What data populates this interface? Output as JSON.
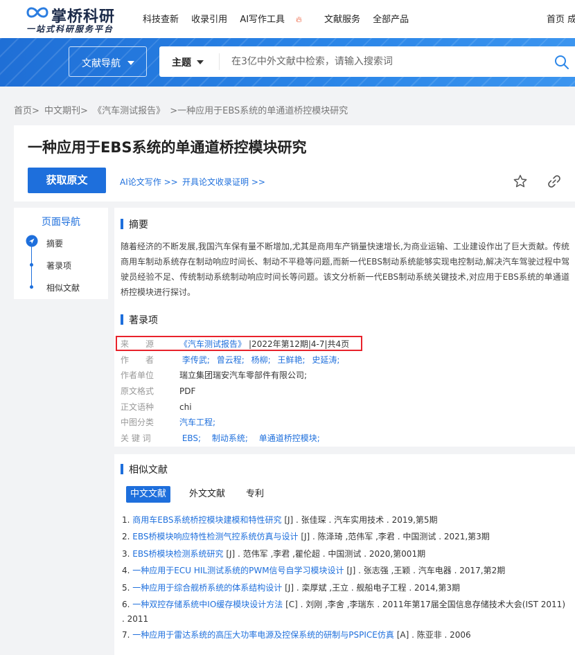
{
  "header": {
    "logo_title": "掌桥科研",
    "logo_subtitle": "一站式科研服务平台",
    "nav": [
      "科技查新",
      "收录引用",
      "AI写作工具",
      "文献服务",
      "全部产品"
    ],
    "nav_right": "首页 成"
  },
  "banner": {
    "lit_nav_label": "文献导航",
    "search_scope": "主题",
    "search_placeholder": "在3亿中外文献中检索，请输入搜索词"
  },
  "breadcrumb": [
    "首页>",
    "中文期刊>",
    "《汽车测试报告》",
    ">一种应用于EBS系统的单通道桥控模块研究"
  ],
  "paper": {
    "title": "一种应用于EBS系统的单通道桥控模块研究",
    "get_button": "获取原文",
    "link_ai": "AI论文写作 >>",
    "link_cert": "开具论文收录证明 >>"
  },
  "page_nav": {
    "title": "页面导航",
    "items": [
      "摘要",
      "著录项",
      "相似文献"
    ]
  },
  "abstract": {
    "heading": "摘要",
    "text": "随着经济的不断发展,我国汽车保有量不断增加,尤其是商用车产销量快速增长,为商业运输、工业建设作出了巨大贡献。传统商用车制动系统存在制动响应时间长、制动不平稳等问题,而新一代EBS制动系统能够实现电控制动,解决汽车驾驶过程中驾驶员经验不足、传统制动系统制动响应时间长等问题。该文分析新一代EBS制动系统关键技术,对应用于EBS系统的单通道桥控模块进行探讨。"
  },
  "record": {
    "heading": "著录项",
    "source": {
      "key": "来　　源",
      "journal": "《汽车测试报告》",
      "rest": "|2022年第12期|4-7|共4页"
    },
    "authors": {
      "key": "作　　者",
      "values": [
        "李传武;",
        "曾云程;",
        "杨柳;",
        "王鲜艳;",
        "史延涛;"
      ]
    },
    "affiliation": {
      "key": "作者单位",
      "value": "瑞立集团瑞安汽车零部件有限公司;"
    },
    "format": {
      "key": "原文格式",
      "value": "PDF"
    },
    "language": {
      "key": "正文语种",
      "value": "chi"
    },
    "classification": {
      "key": "中图分类",
      "value": "汽车工程;"
    },
    "keywords": {
      "key": "关 键 词",
      "values": [
        "EBS;",
        "制动系统;",
        "单通道桥控模块;"
      ]
    }
  },
  "similar": {
    "heading": "相似文献",
    "tabs": [
      "中文文献",
      "外文文献",
      "专利"
    ],
    "refs": [
      {
        "num": "1.",
        "title": "商用车EBS系统桥控模块建模和特性研究",
        "rest": " [J] . 张佳琛 . 汽车实用技术 . 2019,第5期"
      },
      {
        "num": "2.",
        "title": "EBS桥模块响应特性检测气控系统仿真与设计",
        "rest": " [J] . 陈泽琦 ,范伟军 ,李君 . 中国测试 . 2021,第3期"
      },
      {
        "num": "3.",
        "title": "EBS桥模块检测系统研究",
        "rest": " [J] . 范伟军 ,李君 ,瞿伦超 . 中国测试 . 2020,第001期"
      },
      {
        "num": "4.",
        "title": "一种应用于ECU HIL测试系统的PWM信号自学习模块设计",
        "rest": " [J] . 张志强 ,王颖 . 汽车电器 . 2017,第2期"
      },
      {
        "num": "5.",
        "title": "一种应用于综合舰桥系统的体系结构设计",
        "rest": " [J] . 栾厚斌 ,王立 . 舰船电子工程 . 2014,第3期"
      },
      {
        "num": "6.",
        "title": "一种双控存储系统中IO缓存模块设计方法",
        "rest": " [C] . 刘刚 ,李舍 ,李瑞东 . 2011年第17届全国信息存储技术大会(IST 2011) . 2011"
      },
      {
        "num": "7.",
        "title": "一种应用于雷达系统的高压大功率电源及控保系统的研制与PSPICE仿真",
        "rest": " [A] . 陈亚非 . 2006"
      }
    ]
  }
}
